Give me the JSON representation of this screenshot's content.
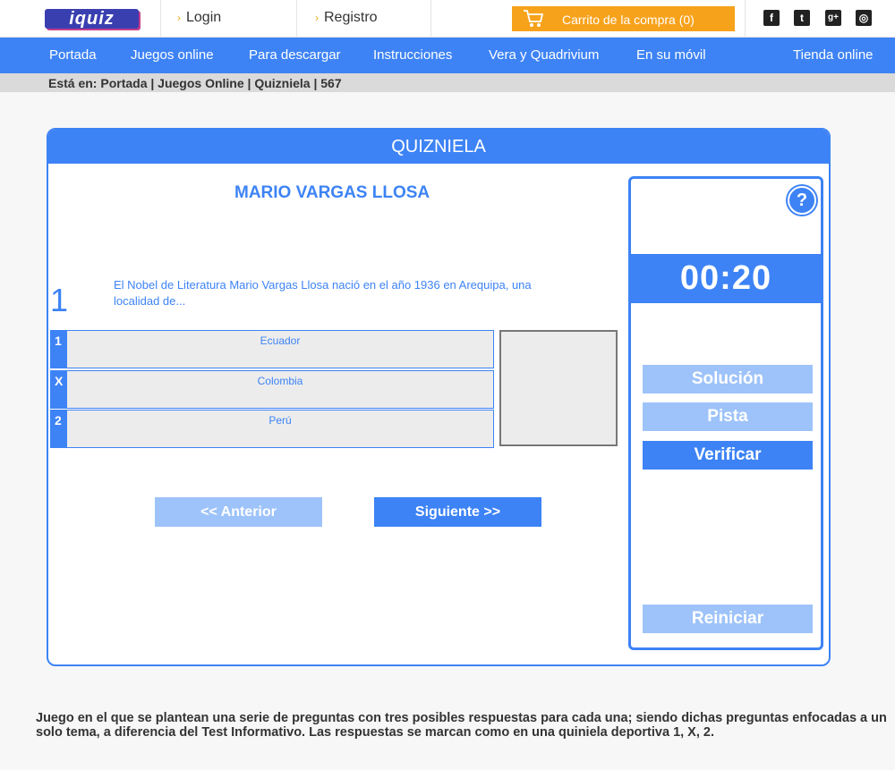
{
  "header": {
    "logo": "iquiz",
    "login": "Login",
    "registro": "Registro",
    "cart": "Carrito de la compra (0)",
    "social": [
      {
        "icon": "facebook-icon",
        "glyph": "f"
      },
      {
        "icon": "twitter-icon",
        "glyph": "t"
      },
      {
        "icon": "google-plus-icon",
        "glyph": "g+"
      },
      {
        "icon": "instagram-icon",
        "glyph": "◎"
      }
    ]
  },
  "nav": {
    "portada": "Portada",
    "juegos": "Juegos online",
    "descargar": "Para descargar",
    "instrucciones": "Instrucciones",
    "vera": "Vera y Quadrivium",
    "movil": "En su móvil",
    "tienda": "Tienda online"
  },
  "breadcrumb": "Está en: Portada | Juegos Online | Quizniela | 567",
  "game": {
    "title": "QUIZNIELA",
    "theme": "MARIO VARGAS LLOSA",
    "question_number": "1",
    "question": "El Nobel de Literatura Mario Vargas Llosa nació en el año 1936 en Arequipa, una localidad de...",
    "answers": [
      {
        "key": "1",
        "text": "Ecuador"
      },
      {
        "key": "X",
        "text": "Colombia"
      },
      {
        "key": "2",
        "text": "Perú"
      }
    ],
    "prev": "<< Anterior",
    "next": "Siguiente >>"
  },
  "side": {
    "help": "?",
    "timer": "00:20",
    "solucion": "Solución",
    "pista": "Pista",
    "verificar": "Verificar",
    "reiniciar": "Reiniciar"
  },
  "description": "Juego en el que se plantean una serie de preguntas con tres posibles respuestas para cada una; siendo dichas preguntas enfocadas a un solo tema, a diferencia del Test Informativo. Las respuestas se marcan como en una quiniela deportiva 1, X, 2.",
  "colors": {
    "accent": "#3d83f5",
    "accent_light": "#9ec3fa",
    "cart": "#f7a21b"
  }
}
